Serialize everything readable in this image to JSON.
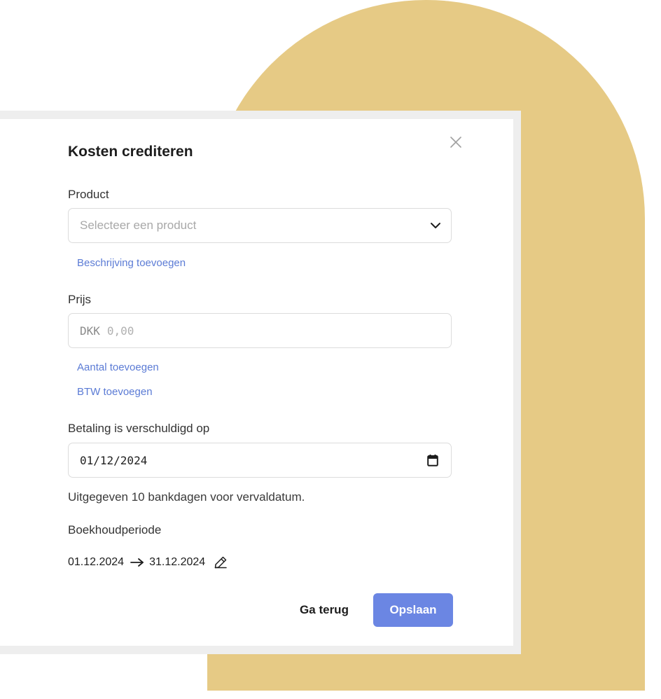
{
  "colors": {
    "accent": "#6b86e3",
    "link": "#5b7bd5",
    "decoration": "#e6ca85"
  },
  "dialog": {
    "title": "Kosten crediteren",
    "close_icon": "close-icon"
  },
  "product": {
    "label": "Product",
    "placeholder": "Selecteer een product",
    "dropdown_icon": "chevron-down-icon",
    "add_description_link": "Beschrijving toevoegen"
  },
  "price": {
    "label": "Prijs",
    "currency": "DKK",
    "placeholder": "0,00",
    "add_quantity_link": "Aantal toevoegen",
    "add_vat_link": "BTW toevoegen"
  },
  "due_date": {
    "label": "Betaling is verschuldigd op",
    "value": "01/12/2024",
    "calendar_icon": "calendar-icon",
    "helper_text": "Uitgegeven 10 bankdagen voor vervaldatum."
  },
  "accounting_period": {
    "label": "Boekhoudperiode",
    "start": "01.12.2024",
    "end": "31.12.2024",
    "arrow_icon": "arrow-right-icon",
    "edit_icon": "pencil-icon"
  },
  "actions": {
    "back_label": "Ga terug",
    "save_label": "Opslaan"
  }
}
